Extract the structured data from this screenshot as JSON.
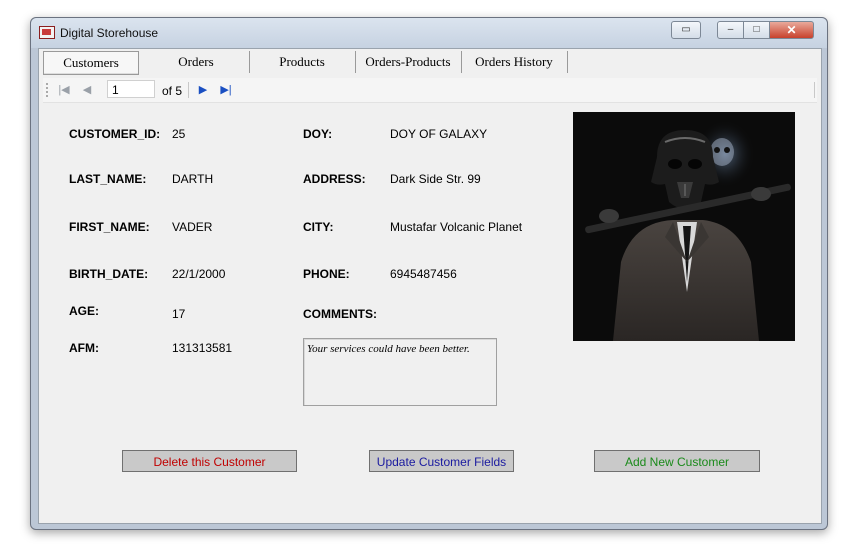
{
  "window": {
    "title": "Digital Storehouse"
  },
  "tabs": [
    {
      "label": "Customers",
      "active": true
    },
    {
      "label": "Orders",
      "active": false
    },
    {
      "label": "Products",
      "active": false
    },
    {
      "label": "Orders-Products",
      "active": false
    },
    {
      "label": "Orders History",
      "active": false
    }
  ],
  "navigator": {
    "position": "1",
    "count_label": "of 5",
    "icons": [
      "move-first-icon",
      "move-previous-icon",
      "move-next-icon",
      "move-last-icon"
    ]
  },
  "fields": {
    "customer_id": {
      "label": "CUSTOMER_ID:",
      "value": "25"
    },
    "last_name": {
      "label": "LAST_NAME:",
      "value": "DARTH"
    },
    "first_name": {
      "label": "FIRST_NAME:",
      "value": "VADER"
    },
    "birth_date": {
      "label": "BIRTH_DATE:",
      "value": "22/1/2000"
    },
    "age": {
      "label": "AGE:",
      "value": "17"
    },
    "afm": {
      "label": "AFM:",
      "value": "131313581"
    },
    "doy": {
      "label": "DOY:",
      "value": "DOY OF GALAXY"
    },
    "address": {
      "label": "ADDRESS:",
      "value": "Dark Side Str. 99"
    },
    "city": {
      "label": "CITY:",
      "value": "Mustafar Volcanic Planet"
    },
    "phone": {
      "label": "PHONE:",
      "value": "6945487456"
    },
    "comments": {
      "label": "COMMENTS:",
      "value": "Your services could have been better."
    }
  },
  "buttons": {
    "delete": {
      "label": "Delete this Customer",
      "color": "#c00000"
    },
    "update": {
      "label": "Update Customer Fields",
      "color": "#1a1aa0"
    },
    "add": {
      "label": "Add New Customer",
      "color": "#1a8a1a"
    }
  }
}
